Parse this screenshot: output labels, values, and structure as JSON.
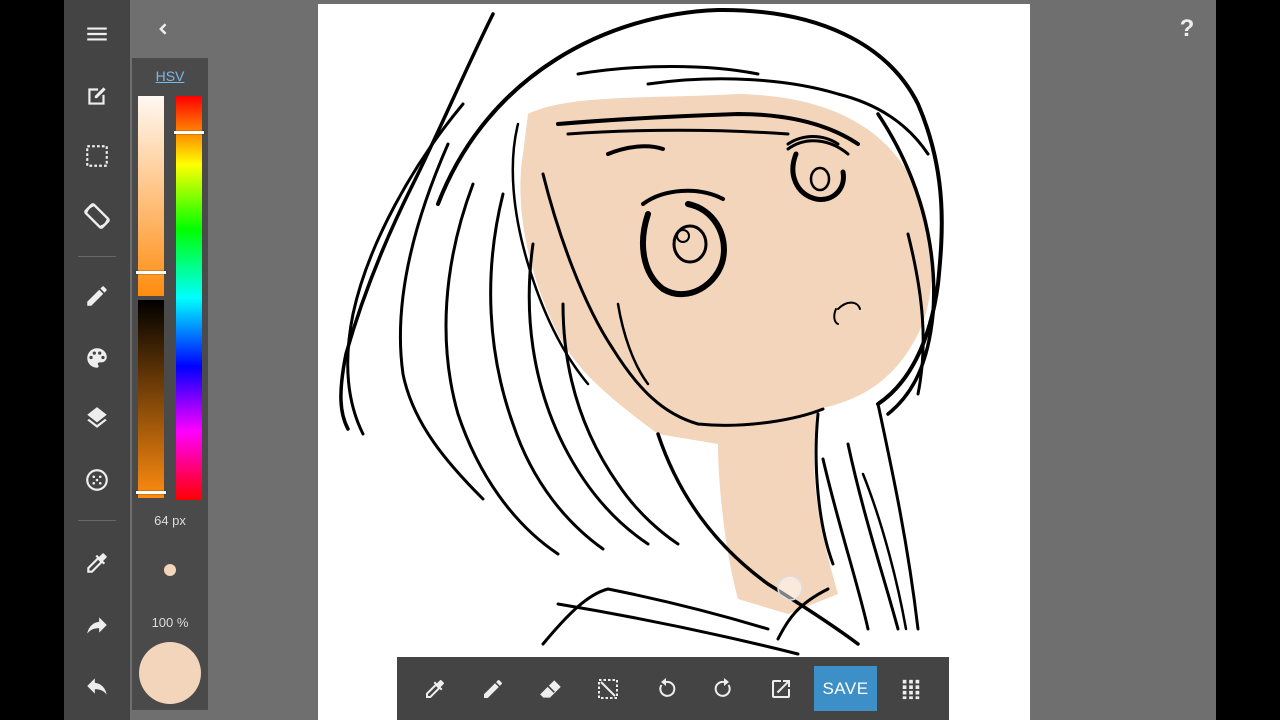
{
  "app": {
    "toolbar": {
      "items": [
        {
          "name": "menu",
          "icon": "menu-icon"
        },
        {
          "name": "new-canvas",
          "icon": "edit-square-icon"
        },
        {
          "name": "selection",
          "icon": "selection-icon"
        },
        {
          "name": "rotate-screen",
          "icon": "screen-rotation-icon"
        },
        {
          "name": "brush",
          "icon": "brush-icon"
        },
        {
          "name": "palette",
          "icon": "palette-icon"
        },
        {
          "name": "layers",
          "icon": "layers-icon"
        },
        {
          "name": "halftone",
          "icon": "halftone-icon"
        },
        {
          "name": "eyedropper",
          "icon": "eyedropper-icon"
        },
        {
          "name": "redo",
          "icon": "redo-icon"
        },
        {
          "name": "undo",
          "icon": "undo-icon"
        }
      ]
    },
    "top": {
      "back_icon": "chevron-left-icon",
      "help_label": "?"
    },
    "color_panel": {
      "mode_label": "HSV",
      "saturation_level": 0.88,
      "value_level": 0.97,
      "hue_level": 0.09,
      "brush_size_label": "64 px",
      "opacity_label": "100 %",
      "current_color": "#f2d5bb"
    },
    "bottom_bar": {
      "tools": [
        "eyedropper-icon",
        "pen-icon",
        "eraser-icon",
        "deselect-icon",
        "undo-icon",
        "redo-icon",
        "export-icon"
      ],
      "save_label": "SAVE",
      "more_icon": "grid-dots-icon"
    },
    "colors": {
      "app_bg": "#6f6f6f",
      "toolbar_bg": "#444444",
      "accent": "#3d8fc7",
      "skin": "#f2d5bb",
      "hsv_link": "#7ab8e8"
    }
  }
}
